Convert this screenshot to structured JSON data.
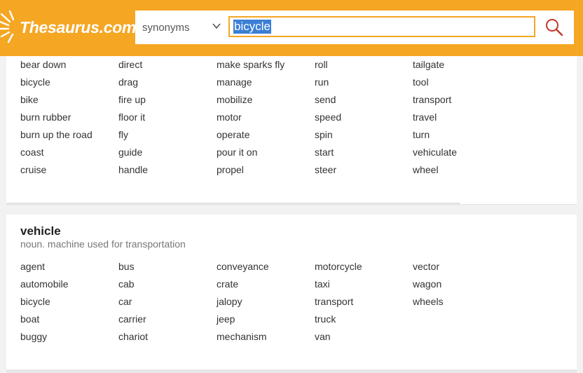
{
  "header": {
    "logo_text": "Thesaurus.com",
    "brand_color": "#f5a623",
    "search_type": "synonyms",
    "search_value": "bicycle"
  },
  "section1": {
    "words": [
      "bear down",
      "bicycle",
      "bike",
      "burn rubber",
      "burn up the road",
      "coast",
      "cruise",
      "direct",
      "drag",
      "fire up",
      "floor it",
      "fly",
      "guide",
      "handle",
      "make sparks fly",
      "manage",
      "mobilize",
      "motor",
      "operate",
      "pour it on",
      "propel",
      "roll",
      "run",
      "send",
      "speed",
      "spin",
      "start",
      "steer",
      "tailgate",
      "tool",
      "transport",
      "travel",
      "turn",
      "vehiculate",
      "wheel"
    ]
  },
  "section2": {
    "title": "vehicle",
    "definition": "noun. machine used for transportation",
    "columns": [
      [
        "agent",
        "automobile",
        "bicycle",
        "boat",
        "buggy"
      ],
      [
        "bus",
        "cab",
        "car",
        "carrier",
        "chariot"
      ],
      [
        "conveyance",
        "crate",
        "jalopy",
        "jeep",
        "mechanism"
      ],
      [
        "motorcycle",
        "taxi",
        "transport",
        "truck",
        "van"
      ],
      [
        "vector",
        "wagon",
        "wheels"
      ]
    ]
  }
}
